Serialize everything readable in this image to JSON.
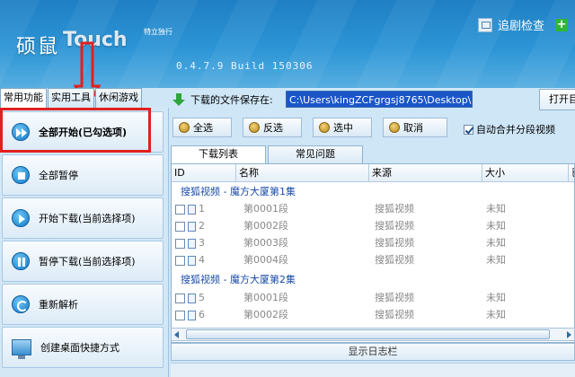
{
  "header": {
    "logo_cn": "硕鼠",
    "logo_en": "Touch",
    "slogan": "特立独行",
    "version": "0.4.7.9  Build 150306",
    "track_label": "追剧检查",
    "add_glyph": "+"
  },
  "tabs": [
    {
      "label": "常用功能"
    },
    {
      "label": "实用工具"
    },
    {
      "label": "休闲游戏"
    }
  ],
  "sidebar": {
    "items": [
      {
        "label": "全部开始(已勾选项)"
      },
      {
        "label": "全部暂停"
      },
      {
        "label": "开始下载(当前选择项)"
      },
      {
        "label": "暂停下载(当前选择项)"
      },
      {
        "label": "重新解析"
      },
      {
        "label": "创建桌面快捷方式"
      }
    ]
  },
  "pathbar": {
    "label": "下载的文件保存在:",
    "value": "C:\\Users\\kingZCFgrgsj8765\\Desktop\\",
    "open_label": "打开目"
  },
  "toolbar": {
    "select_all": "全选",
    "invert": "反选",
    "select_checked": "选中",
    "cancel": "取消",
    "auto_merge": "自动合并分段视频"
  },
  "subtabs": [
    {
      "label": "下载列表"
    },
    {
      "label": "常见问题"
    }
  ],
  "grid": {
    "columns": [
      "ID",
      "名称",
      "来源",
      "大小",
      "已"
    ],
    "groups": [
      {
        "title": "搜狐视频 - 魔方大厦第1集",
        "rows": [
          {
            "id": "1",
            "name": "第0001段",
            "source": "搜狐视频",
            "size": "未知"
          },
          {
            "id": "2",
            "name": "第0002段",
            "source": "搜狐视频",
            "size": "未知"
          },
          {
            "id": "3",
            "name": "第0003段",
            "source": "搜狐视频",
            "size": "未知"
          },
          {
            "id": "4",
            "name": "第0004段",
            "source": "搜狐视频",
            "size": "未知"
          }
        ]
      },
      {
        "title": "搜狐视频 - 魔方大厦第2集",
        "rows": [
          {
            "id": "5",
            "name": "第0001段",
            "source": "搜狐视频",
            "size": "未知"
          },
          {
            "id": "6",
            "name": "第0002段",
            "source": "搜狐视频",
            "size": "未知"
          }
        ]
      }
    ]
  },
  "logbar": {
    "label": "显示日志栏"
  },
  "colors": {
    "highlight": "#e0211f",
    "path_bg": "#1a56c8",
    "group_text": "#1a4ca8"
  }
}
